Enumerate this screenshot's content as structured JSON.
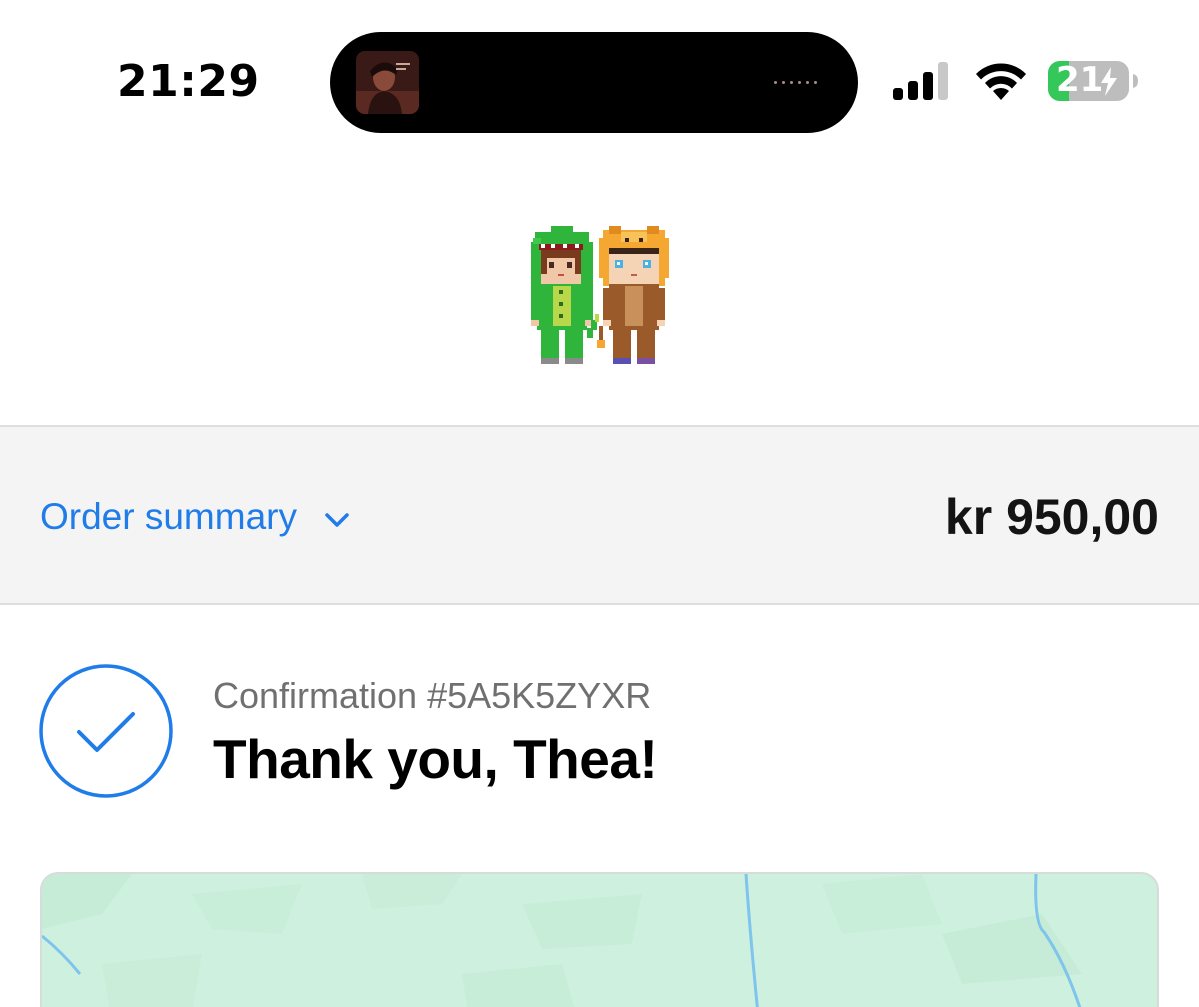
{
  "status_bar": {
    "time": "21:29",
    "battery_level": "21",
    "icons": [
      "media-artwork-icon",
      "signal-icon",
      "wifi-icon",
      "battery-charging-icon"
    ]
  },
  "header": {
    "logo": "pixel-characters-logo"
  },
  "summary": {
    "label": "Order summary",
    "total": "kr 950,00",
    "chevron": "chevron-down-icon"
  },
  "confirmation": {
    "number_text": "Confirmation #5A5K5ZYXR",
    "heading": "Thank you, Thea!",
    "icon": "check-circle-icon"
  },
  "colors": {
    "accent": "#1f7ce8",
    "summary_bg": "#f4f4f4",
    "map_bg": "#cdf1de",
    "battery_green": "#34c759"
  }
}
